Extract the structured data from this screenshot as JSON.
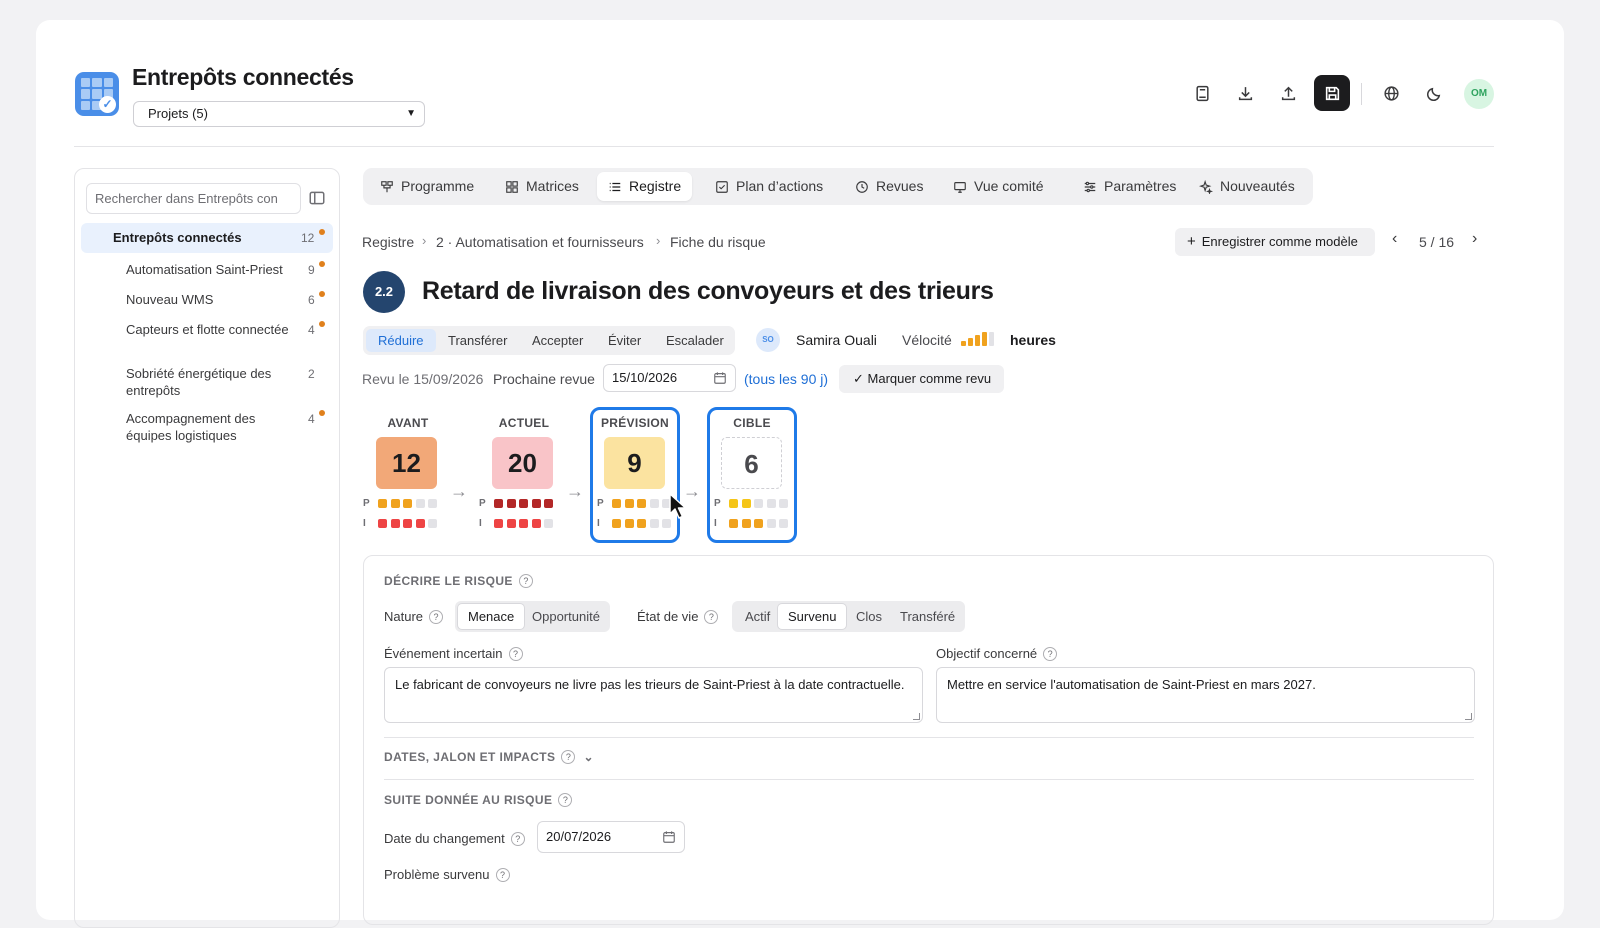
{
  "app": {
    "title": "Entrepôts connectés",
    "project_select": "Projets (5)",
    "avatar_initials": "OM"
  },
  "sidebar": {
    "search_placeholder": "Rechercher dans Entrepôts con",
    "root": {
      "label": "Entrepôts connectés",
      "count": "12"
    },
    "items": [
      {
        "label": "Automatisation Saint-Priest",
        "count": "9",
        "flag": true
      },
      {
        "label": "Nouveau WMS",
        "count": "6",
        "flag": true
      },
      {
        "label": "Capteurs et flotte connectée",
        "count": "4",
        "flag": true
      },
      {
        "label": "Sobriété énergétique des entrepôts",
        "count": "2",
        "flag": false
      },
      {
        "label": "Accompagnement des équipes logistiques",
        "count": "4",
        "flag": true
      }
    ]
  },
  "tabs": [
    {
      "label": "Programme",
      "icon": "program-icon"
    },
    {
      "label": "Matrices",
      "icon": "grid-icon"
    },
    {
      "label": "Registre",
      "icon": "list-icon",
      "active": true
    },
    {
      "label": "Plan d’actions",
      "icon": "checkbox-icon"
    },
    {
      "label": "Revues",
      "icon": "clock-icon"
    },
    {
      "label": "Vue comité",
      "icon": "monitor-icon"
    },
    {
      "label": "Paramètres",
      "icon": "sliders-icon"
    },
    {
      "label": "Nouveautés",
      "icon": "sparkle-icon"
    }
  ],
  "breadcrumb": [
    "Registre",
    "2 · Automatisation et fournisseurs",
    "Fiche du risque"
  ],
  "save_model_label": "Enregistrer comme modèle",
  "pager": "5 / 16",
  "risk": {
    "id": "2.2",
    "title": "Retard de livraison des convoyeurs et des trieurs",
    "strategies": [
      "Réduire",
      "Transférer",
      "Accepter",
      "Éviter",
      "Escalader"
    ],
    "active_strategy": "Réduire",
    "owner_initials": "SO",
    "owner_name": "Samira Ouali",
    "velocity_label": "Vélocité",
    "velocity_level": 3,
    "velocity_value": "heures",
    "reviewed": "Revu le 15/09/2026",
    "next_review_label": "Prochaine revue",
    "next_review_date": "15/10/2026",
    "frequency": "(tous les 90 j)",
    "mark_reviewed": "Marquer comme revu"
  },
  "scores": [
    {
      "label": "AVANT",
      "value": "12",
      "p": 3,
      "i": 4,
      "bg": "#f2a878"
    },
    {
      "label": "ACTUEL",
      "value": "20",
      "p": 5,
      "i": 4,
      "bg": "#f9c4c8"
    },
    {
      "label": "PRÉVISION",
      "value": "9",
      "p": 3,
      "i": 3,
      "bg": "#fbe3a0"
    },
    {
      "label": "CIBLE",
      "value": "6",
      "p": 2,
      "i": 3,
      "bg": "#ffffff"
    }
  ],
  "score_axes": {
    "p": "P",
    "i": "I"
  },
  "describe": {
    "title": "DÉCRIRE LE RISQUE",
    "nature_label": "Nature",
    "nature_options": [
      "Menace",
      "Opportunité"
    ],
    "nature_selected": "Menace",
    "state_label": "État de vie",
    "state_options": [
      "Actif",
      "Survenu",
      "Clos",
      "Transféré"
    ],
    "state_selected": "Survenu",
    "event_label": "Événement incertain",
    "event_value": "Le fabricant de convoyeurs ne livre pas les trieurs de Saint-Priest à la date contractuelle.",
    "objective_label": "Objectif concerné",
    "objective_value": "Mettre en service l'automatisation de Saint-Priest en mars 2027."
  },
  "dates_section": {
    "title": "DATES, JALON ET IMPACTS"
  },
  "follow": {
    "title": "SUITE DONNÉE AU RISQUE",
    "change_date_label": "Date du changement",
    "change_date": "20/07/2026",
    "problem_label": "Problème survenu"
  },
  "colors": {
    "accent": "#1f7ae8",
    "flag": "#e0801c",
    "p_orange": "#f0a21e",
    "dark_red": "#b32727",
    "red": "#ee4444",
    "yellow": "#f5c518",
    "empty": "#e2e2e6"
  }
}
